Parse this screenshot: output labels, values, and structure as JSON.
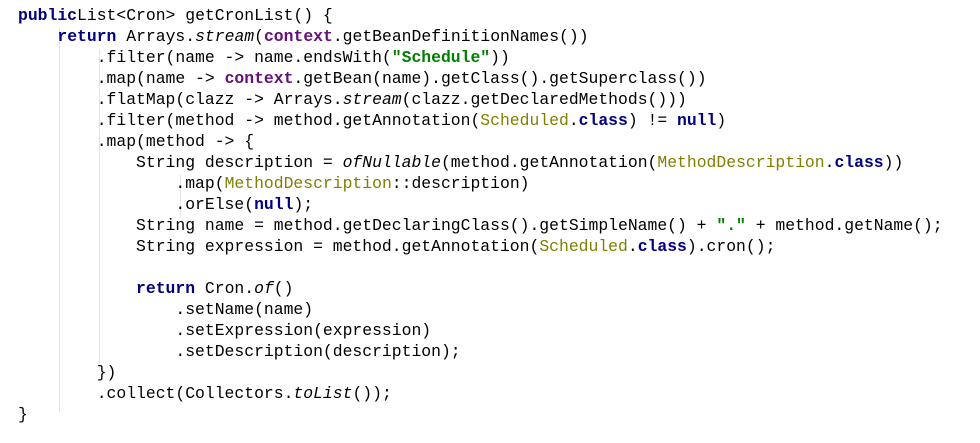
{
  "colors": {
    "keyword": "#000080",
    "field": "#660E7A",
    "string": "#008000",
    "annotation": "#808000"
  },
  "lines": [
    [
      [
        "k",
        "public"
      ],
      [
        "",
        "List<Cron> getCronList() {"
      ]
    ],
    [
      [
        "",
        "    "
      ],
      [
        "k",
        "return"
      ],
      [
        "",
        " Arrays."
      ],
      [
        "i",
        "stream"
      ],
      [
        "",
        "("
      ],
      [
        "f",
        "context"
      ],
      [
        "",
        ".getBeanDefinitionNames())"
      ]
    ],
    [
      [
        "",
        "        .filter(name -> name.endsWith("
      ],
      [
        "s",
        "\"Schedule\""
      ],
      [
        "",
        "))"
      ]
    ],
    [
      [
        "",
        "        .map(name -> "
      ],
      [
        "f",
        "context"
      ],
      [
        "",
        ".getBean(name).getClass().getSuperclass())"
      ]
    ],
    [
      [
        "",
        "        .flatMap(clazz -> Arrays."
      ],
      [
        "i",
        "stream"
      ],
      [
        "",
        "(clazz.getDeclaredMethods()))"
      ]
    ],
    [
      [
        "",
        "        .filter(method -> method.getAnnotation("
      ],
      [
        "a",
        "Scheduled"
      ],
      [
        "",
        "."
      ],
      [
        "k",
        "class"
      ],
      [
        "",
        ") != "
      ],
      [
        "k",
        "null"
      ],
      [
        "",
        ")"
      ]
    ],
    [
      [
        "",
        "        .map(method -> {"
      ]
    ],
    [
      [
        "",
        "            String description = "
      ],
      [
        "i",
        "ofNullable"
      ],
      [
        "",
        "(method.getAnnotation("
      ],
      [
        "a",
        "MethodDescription"
      ],
      [
        "",
        "."
      ],
      [
        "k",
        "class"
      ],
      [
        "",
        "))"
      ]
    ],
    [
      [
        "",
        "                .map("
      ],
      [
        "a",
        "MethodDescription"
      ],
      [
        "",
        "::description)"
      ]
    ],
    [
      [
        "",
        "                .orElse("
      ],
      [
        "k",
        "null"
      ],
      [
        "",
        ");"
      ]
    ],
    [
      [
        "",
        "            String name = method.getDeclaringClass().getSimpleName() + "
      ],
      [
        "s",
        "\".\""
      ],
      [
        "",
        " + method.getName();"
      ]
    ],
    [
      [
        "",
        "            String expression = method.getAnnotation("
      ],
      [
        "a",
        "Scheduled"
      ],
      [
        "",
        "."
      ],
      [
        "k",
        "class"
      ],
      [
        "",
        ").cron();"
      ]
    ],
    [
      [
        "",
        ""
      ]
    ],
    [
      [
        "",
        "            "
      ],
      [
        "k",
        "return"
      ],
      [
        "",
        " Cron."
      ],
      [
        "i",
        "of"
      ],
      [
        "",
        "()"
      ]
    ],
    [
      [
        "",
        "                .setName(name)"
      ]
    ],
    [
      [
        "",
        "                .setExpression(expression)"
      ]
    ],
    [
      [
        "",
        "                .setDescription(description);"
      ]
    ],
    [
      [
        "",
        "        })"
      ]
    ],
    [
      [
        "",
        "        .collect(Collectors."
      ],
      [
        "i",
        "toList"
      ],
      [
        "",
        "());"
      ]
    ],
    [
      [
        "",
        "}"
      ]
    ]
  ]
}
